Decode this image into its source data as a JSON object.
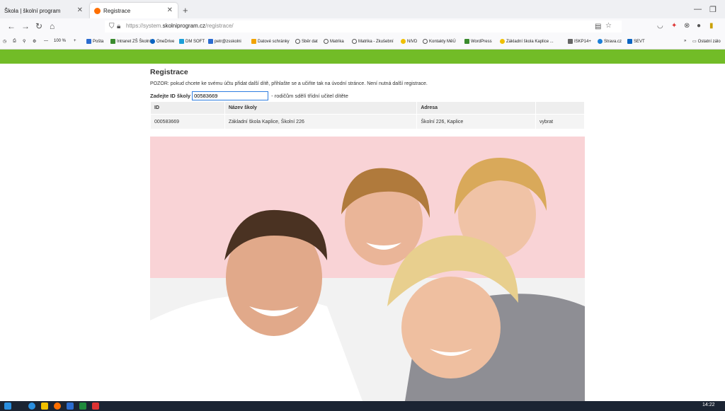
{
  "browser": {
    "tabs": [
      {
        "label": "Škola | školní program"
      },
      {
        "label": "Registrace"
      }
    ],
    "url": {
      "prefix": "https://system.",
      "domain": "skolniprogram.cz",
      "path": "/registrace/"
    },
    "zoom": "100 %",
    "bookmarks": [
      "Pošta",
      "Intranet ZŠ Školní",
      "OneDrive",
      "DM SOFT",
      "petr@zsskolni",
      "Datové schránky",
      "Sběr dat",
      "Matrika",
      "Matrika - Zkušební",
      "NIVD",
      "Kontakty MěÚ",
      "WordPress",
      "Základní škola Kaplice ...",
      "ISKP14+",
      "Strava.cz",
      "SEVT"
    ],
    "other_bookmarks": "Ostatní zálo"
  },
  "page": {
    "title": "Registrace",
    "note": "POZOR: pokud chcete ke svému účtu přidat další dítě, přihlašte se a učiňte tak na úvodní stránce. Není nutná další registrace.",
    "id_label": "Zadejte ID školy",
    "id_value": "00583669",
    "id_hint": "- rodičům sdělí třídní učitel dítěte",
    "table": {
      "headers": [
        "ID",
        "Název školy",
        "Adresa",
        ""
      ],
      "rows": [
        {
          "id": "000583669",
          "name": "Základní škola Kaplice, Školní 226",
          "address": "Školní 226, Kaplice",
          "action": "vybrat"
        }
      ]
    }
  },
  "taskbar": {
    "time": "14:22"
  },
  "colors": {
    "green_bar": "#72bc27",
    "photo_bg": "#f9d3d6",
    "taskbar": "#1b2433"
  }
}
